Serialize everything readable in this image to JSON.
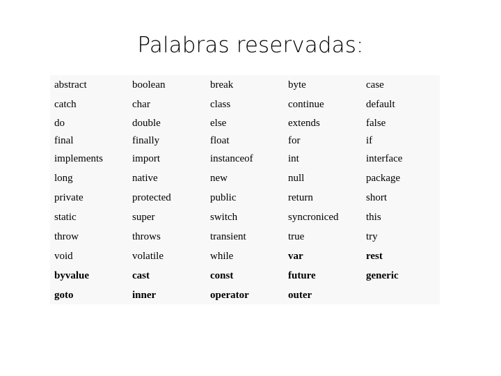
{
  "slide": {
    "title": "Palabras reservadas:",
    "background_color": "#ffffff",
    "text_color": "#000000"
  },
  "table": {
    "background_color": "#f8f8f8",
    "columns": 5,
    "rows": [
      {
        "style": "normal",
        "cells": [
          "abstract",
          "boolean",
          "break",
          "byte",
          "case"
        ]
      },
      {
        "style": "normal",
        "cells": [
          "catch",
          "char",
          "class",
          "continue",
          "default"
        ]
      },
      {
        "style": "tight",
        "cells": [
          "do",
          "double",
          "else",
          "extends",
          "false"
        ]
      },
      {
        "style": "tight",
        "cells": [
          "final",
          "finally",
          "float",
          "for",
          "if"
        ]
      },
      {
        "style": "normal",
        "cells": [
          "implements",
          "import",
          "instanceof",
          "int",
          "interface"
        ]
      },
      {
        "style": "normal",
        "cells": [
          "long",
          "native",
          "new",
          "null",
          "package"
        ]
      },
      {
        "style": "normal",
        "cells": [
          "private",
          "protected",
          "public",
          "return",
          "short"
        ]
      },
      {
        "style": "normal",
        "cells": [
          "static",
          "super",
          "switch",
          "syncroniced",
          "this"
        ]
      },
      {
        "style": "normal",
        "cells": [
          "throw",
          "throws",
          "transient",
          "true",
          "try"
        ]
      },
      {
        "style": "normal-mixed",
        "cells": [
          "void",
          "volatile",
          "while",
          "var",
          "rest"
        ],
        "bold_cells": [
          3,
          4
        ]
      },
      {
        "style": "bold",
        "cells": [
          "byvalue",
          "cast",
          "const",
          "future",
          "generic"
        ]
      },
      {
        "style": "bold",
        "cells": [
          "goto",
          "inner",
          "operator",
          "outer",
          ""
        ]
      }
    ]
  }
}
